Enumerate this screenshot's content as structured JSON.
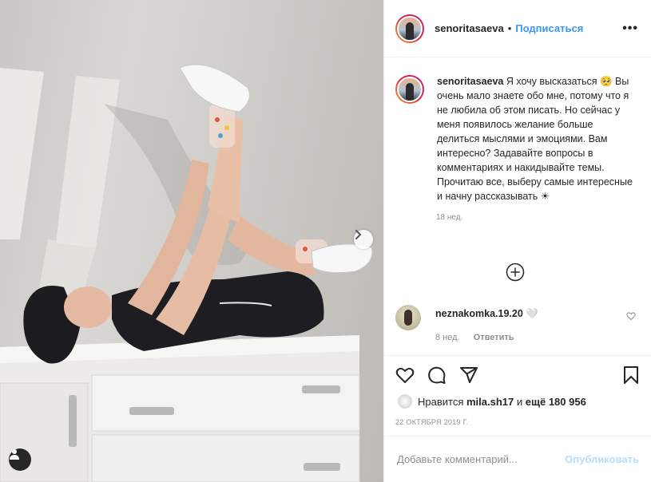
{
  "post": {
    "username": "senoritasaeva",
    "follow_label": "Подписаться",
    "dot": "•",
    "more_label": "•••"
  },
  "caption": {
    "username": "senoritasaeva",
    "text": "Я хочу высказаться 🥺 Вы очень мало знаете обо мне, потому что я не любила об этом писать. Но сейчас у меня появилось желание больше делиться мыслями и эмоциями. Вам интересно? Задавайте вопросы в комментариях и накидывайте темы. Прочитаю все, выберу самые интересные и начну рассказывать ☀",
    "time": "18 нед."
  },
  "comment": {
    "username": "neznakomka.19.20",
    "text": "🤍",
    "time": "8 нед.",
    "reply_label": "Ответить"
  },
  "likes": {
    "prefix": "Нравится",
    "user": "mila.sh17",
    "connector": "и",
    "others": "ещё 180 956"
  },
  "date": "22 ОКТЯБРЯ 2019 Г.",
  "add_comment": {
    "placeholder": "Добавьте комментарий...",
    "publish_label": "Опубликовать"
  },
  "icons": [
    "heart-icon",
    "comment-icon",
    "share-icon",
    "bookmark-icon",
    "plus-circle-icon",
    "chevron-right-icon",
    "user-tag-icon",
    "more-icon"
  ],
  "colors": {
    "link_blue": "#3897f0",
    "publish_disabled": "#b2dffc",
    "muted": "#8e8e8e",
    "text": "#262626"
  }
}
